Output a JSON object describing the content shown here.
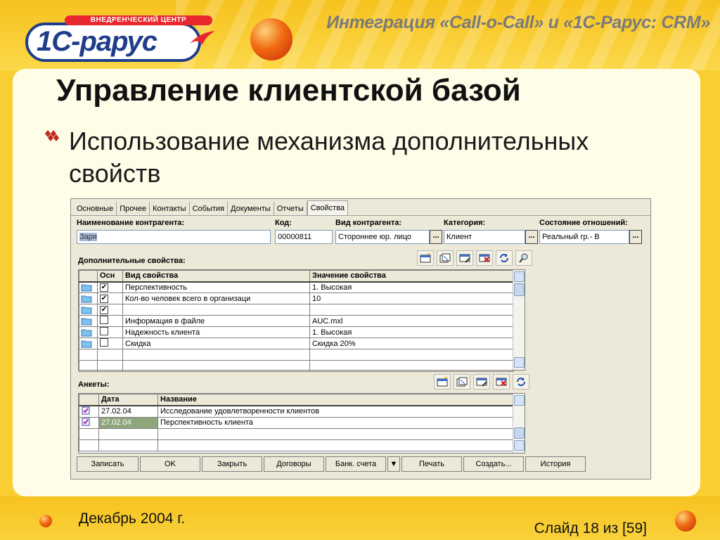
{
  "slide": {
    "logo_badge": "ВНЕДРЕНЧЕСКИЙ ЦЕНТР",
    "logo_text": "1С-рарус",
    "header_title": "Интеграция «Call-o-Call» и «1С-Рарус: CRM»",
    "title": "Управление клиентской базой",
    "bullet": "Использование механизма дополнительных свойств",
    "date": "Декабрь 2004 г.",
    "slide_number": "Слайд 18 из [59]"
  },
  "window": {
    "tabs": [
      {
        "label": "Основные"
      },
      {
        "label": "Прочее"
      },
      {
        "label": "Контакты"
      },
      {
        "label": "События"
      },
      {
        "label": "Документы"
      },
      {
        "label": "Отчеты"
      },
      {
        "label": "Свойства"
      }
    ],
    "active_tab": "Свойства",
    "fields": {
      "name_label": "Наименование контрагента:",
      "name_value": "Заря",
      "code_label": "Код:",
      "code_value": "00000811",
      "kind_label": "Вид контрагента:",
      "kind_value": "Стороннее юр. лицо",
      "category_label": "Категория:",
      "category_value": "Клиент",
      "relation_label": "Состояние отношений:",
      "relation_value": "Реальный гр.- В",
      "dots": "..."
    },
    "properties": {
      "label": "Дополнительные свойства:",
      "columns": [
        "Осн",
        "Вид свойства",
        "Значение свойства"
      ],
      "rows": [
        {
          "main": "✔",
          "kind": "Перспективность",
          "value": "1. Высокая"
        },
        {
          "main": "✔",
          "kind": "Кол-во человек всего в организаци",
          "value": "10"
        },
        {
          "main": "✔",
          "kind": "",
          "value": ""
        },
        {
          "main": "",
          "kind": "Информация в файле",
          "value": "AUC.mxl"
        },
        {
          "main": "",
          "kind": "Надежность клиента",
          "value": "1. Высокая"
        },
        {
          "main": "",
          "kind": "Скидка",
          "value": "Скидка 20%"
        }
      ]
    },
    "surveys": {
      "label": "Анкеты:",
      "columns": [
        "Дата",
        "Название"
      ],
      "rows": [
        {
          "date": "27.02.04",
          "name": "Исследование удовлетворенности клиентов"
        },
        {
          "date": "27.02.04",
          "name": "Перспективность клиента"
        }
      ]
    },
    "buttons": {
      "save": "Записать",
      "ok": "OK",
      "close": "Закрыть",
      "contracts": "Договоры",
      "bank_accounts": "Банк. счета",
      "dropdown": "▼",
      "print": "Печать",
      "create": "Создать...",
      "history": "История"
    }
  },
  "colors": {
    "accent_orange": "#f06a12",
    "logo_blue": "#1f3d8a",
    "logo_red": "#e8282e",
    "slide_yellow": "#f9d23c",
    "panel_cream": "#fffde8"
  }
}
